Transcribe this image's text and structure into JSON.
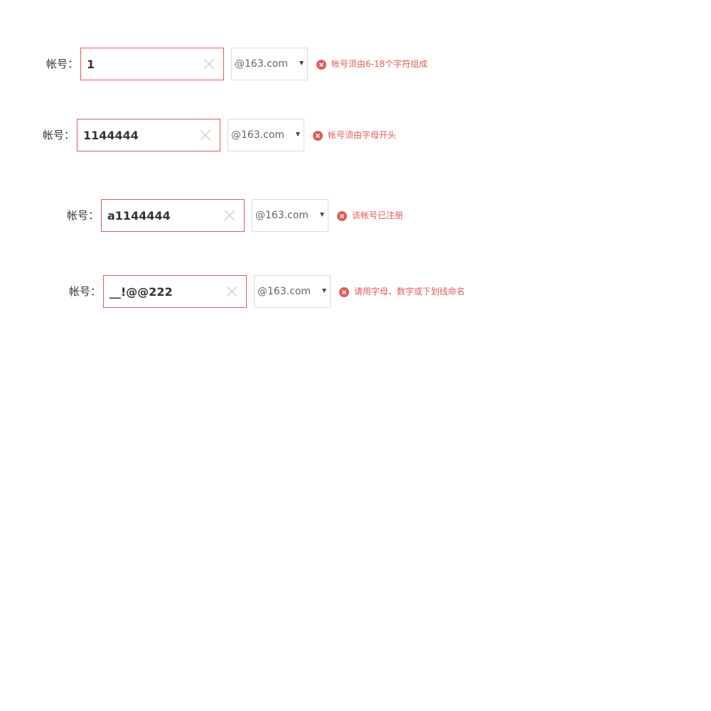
{
  "colors": {
    "error": "#e45a5a",
    "input_border_error": "#e45a5a",
    "select_border": "#dcdcdc",
    "text": "#333333",
    "clear_icon": "#cccccc"
  },
  "icons": {
    "clear": "close-icon",
    "caret": "caret-down-icon",
    "error": "error-circle-icon"
  },
  "rows": [
    {
      "label": "帐号：",
      "value": "1",
      "domain": "@163.com",
      "error": "帐号须由6-18个字符组成"
    },
    {
      "label": "帐号：",
      "value": "1144444",
      "domain": "@163.com",
      "error": "帐号须由字母开头"
    },
    {
      "label": "帐号：",
      "value": "a1144444",
      "domain": "@163.com",
      "error": "该帐号已注册"
    },
    {
      "label": "帐号：",
      "value": "__!@@222",
      "domain": "@163.com",
      "error": "请用字母、数字或下划线命名"
    }
  ]
}
